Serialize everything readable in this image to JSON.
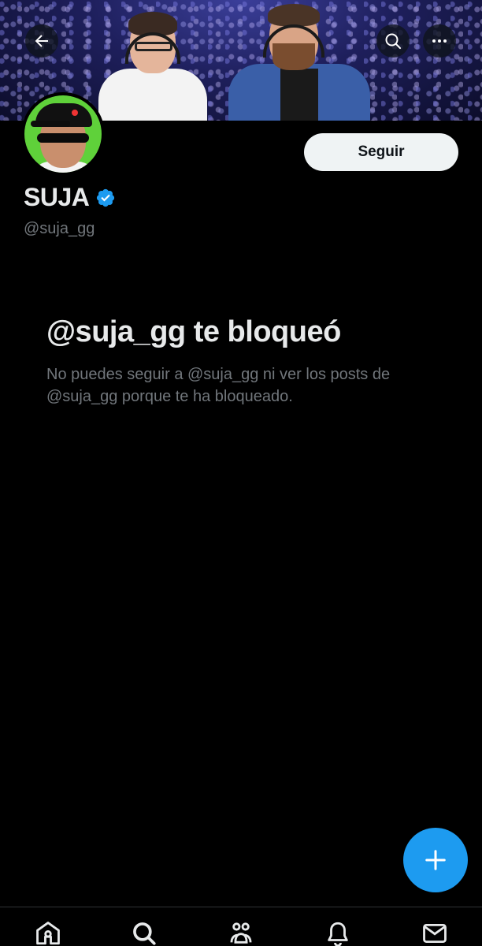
{
  "header": {
    "back_icon": "arrow-left-icon",
    "search_icon": "search-icon",
    "more_icon": "more-horizontal-icon"
  },
  "profile": {
    "display_name": "SUJA",
    "handle": "@suja_gg",
    "verified": true,
    "follow_label": "Seguir"
  },
  "blocked": {
    "title": "@suja_gg te bloqueó",
    "message": "No puedes seguir a @suja_gg ni ver los posts de @suja_gg porque te ha bloqueado."
  },
  "fab": {
    "icon": "plus-icon"
  },
  "bottom_nav": {
    "items": [
      {
        "icon": "home-icon"
      },
      {
        "icon": "search-icon"
      },
      {
        "icon": "communities-icon"
      },
      {
        "icon": "notifications-icon"
      },
      {
        "icon": "messages-icon"
      }
    ]
  },
  "colors": {
    "background": "#000000",
    "accent": "#1d9bf0",
    "text_primary": "#e7e9ea",
    "text_secondary": "#71767b",
    "avatar_ring": "#5fd13a"
  }
}
